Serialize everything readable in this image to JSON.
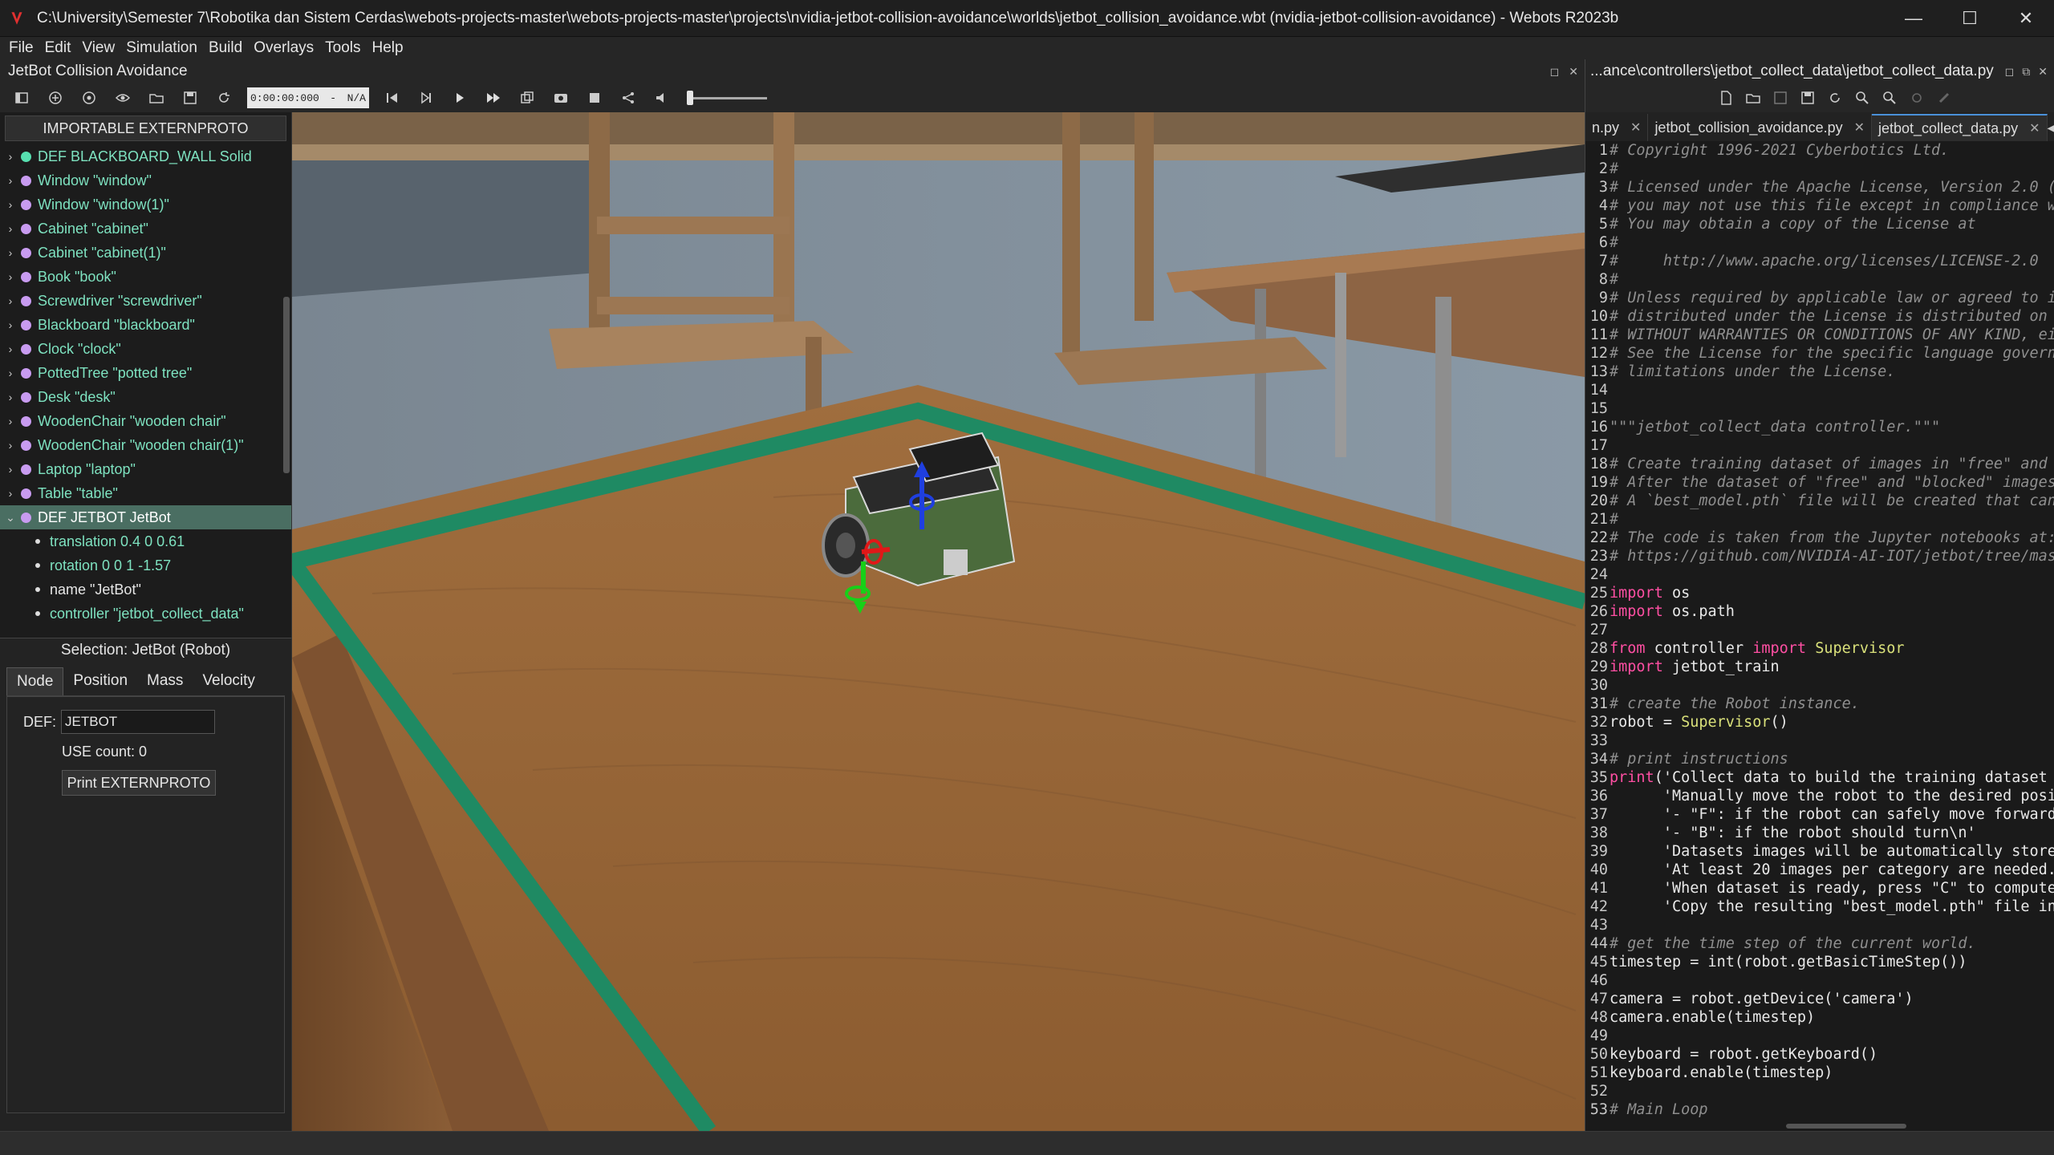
{
  "window": {
    "title": "C:\\University\\Semester 7\\Robotika dan Sistem Cerdas\\webots-projects-master\\webots-projects-master\\projects\\nvidia-jetbot-collision-avoidance\\worlds\\jetbot_collision_avoidance.wbt (nvidia-jetbot-collision-avoidance) - Webots R2023b",
    "minimize": "—",
    "maximize": "☐",
    "close": "✕"
  },
  "menu": [
    "File",
    "Edit",
    "View",
    "Simulation",
    "Build",
    "Overlays",
    "Tools",
    "Help"
  ],
  "left_header": {
    "title": "JetBot Collision Avoidance"
  },
  "toolbar": {
    "time": "0:00:00:000",
    "time_sep": "-",
    "speed": "N/A"
  },
  "scene_tree": {
    "importable_label": "IMPORTABLE EXTERNPROTO",
    "items": [
      {
        "label": "DEF BLACKBOARD_WALL Solid",
        "dot": "green"
      },
      {
        "label": "Window \"window\"",
        "dot": "purple"
      },
      {
        "label": "Window \"window(1)\"",
        "dot": "purple"
      },
      {
        "label": "Cabinet \"cabinet\"",
        "dot": "purple"
      },
      {
        "label": "Cabinet \"cabinet(1)\"",
        "dot": "purple"
      },
      {
        "label": "Book \"book\"",
        "dot": "purple"
      },
      {
        "label": "Screwdriver \"screwdriver\"",
        "dot": "purple"
      },
      {
        "label": "Blackboard \"blackboard\"",
        "dot": "purple"
      },
      {
        "label": "Clock \"clock\"",
        "dot": "purple"
      },
      {
        "label": "PottedTree \"potted tree\"",
        "dot": "purple"
      },
      {
        "label": "Desk \"desk\"",
        "dot": "purple"
      },
      {
        "label": "WoodenChair \"wooden chair\"",
        "dot": "purple"
      },
      {
        "label": "WoodenChair \"wooden chair(1)\"",
        "dot": "purple"
      },
      {
        "label": "Laptop \"laptop\"",
        "dot": "purple"
      },
      {
        "label": "Table \"table\"",
        "dot": "purple"
      },
      {
        "label": "DEF JETBOT JetBot",
        "dot": "purple"
      }
    ],
    "children": [
      {
        "label": "translation 0.4 0 0.61"
      },
      {
        "label": "rotation 0 0 1 -1.57"
      },
      {
        "label": "name \"JetBot\""
      },
      {
        "label": "controller \"jetbot_collect_data\""
      }
    ]
  },
  "selection": {
    "title": "Selection: JetBot (Robot)",
    "tabs": [
      "Node",
      "Position",
      "Mass",
      "Velocity"
    ],
    "def_label": "DEF:",
    "def_value": "JETBOT",
    "use_count": "USE count: 0",
    "print_button": "Print EXTERNPROTO"
  },
  "editor": {
    "path": "...ance\\controllers\\jetbot_collect_data\\jetbot_collect_data.py",
    "tabs": [
      {
        "label": "n.py",
        "active": false
      },
      {
        "label": "jetbot_collision_avoidance.py",
        "active": false
      },
      {
        "label": "jetbot_collect_data.py",
        "active": true
      }
    ],
    "lines": [
      {
        "n": "1",
        "parts": [
          [
            "c",
            "# Copyright 1996-2021 Cyberbotics Ltd."
          ]
        ]
      },
      {
        "n": "2",
        "parts": [
          [
            "c",
            "#"
          ]
        ]
      },
      {
        "n": "3",
        "parts": [
          [
            "c",
            "# Licensed under the Apache License, Version 2.0 ("
          ]
        ]
      },
      {
        "n": "4",
        "parts": [
          [
            "c",
            "# you may not use this file except in compliance w"
          ]
        ]
      },
      {
        "n": "5",
        "parts": [
          [
            "c",
            "# You may obtain a copy of the License at"
          ]
        ]
      },
      {
        "n": "6",
        "parts": [
          [
            "c",
            "#"
          ]
        ]
      },
      {
        "n": "7",
        "parts": [
          [
            "c",
            "#     http://www.apache.org/licenses/LICENSE-2.0"
          ]
        ]
      },
      {
        "n": "8",
        "parts": [
          [
            "c",
            "#"
          ]
        ]
      },
      {
        "n": "9",
        "parts": [
          [
            "c",
            "# Unless required by applicable law or agreed to i"
          ]
        ]
      },
      {
        "n": "10",
        "parts": [
          [
            "c",
            "# distributed under the License is distributed on"
          ]
        ]
      },
      {
        "n": "11",
        "parts": [
          [
            "c",
            "# WITHOUT WARRANTIES OR CONDITIONS OF ANY KIND, ei"
          ]
        ]
      },
      {
        "n": "12",
        "parts": [
          [
            "c",
            "# See the License for the specific language govern"
          ]
        ]
      },
      {
        "n": "13",
        "parts": [
          [
            "c",
            "# limitations under the License."
          ]
        ]
      },
      {
        "n": "14",
        "parts": []
      },
      {
        "n": "15",
        "parts": []
      },
      {
        "n": "16",
        "parts": [
          [
            "c",
            "\"\"\"jetbot_collect_data controller.\"\"\""
          ]
        ]
      },
      {
        "n": "17",
        "parts": []
      },
      {
        "n": "18",
        "parts": [
          [
            "c",
            "# Create training dataset of images in \"free\" and"
          ]
        ]
      },
      {
        "n": "19",
        "parts": [
          [
            "c",
            "# After the dataset of \"free\" and \"blocked\" images"
          ]
        ]
      },
      {
        "n": "20",
        "parts": [
          [
            "c",
            "# A `best_model.pth` file will be created that can"
          ]
        ]
      },
      {
        "n": "21",
        "parts": [
          [
            "c",
            "#"
          ]
        ]
      },
      {
        "n": "22",
        "parts": [
          [
            "c",
            "# The code is taken from the Jupyter notebooks at:"
          ]
        ]
      },
      {
        "n": "23",
        "parts": [
          [
            "c",
            "# https://github.com/NVIDIA-AI-IOT/jetbot/tree/mas"
          ]
        ]
      },
      {
        "n": "24",
        "parts": []
      },
      {
        "n": "25",
        "parts": [
          [
            "k",
            "import"
          ],
          [
            "t",
            " os"
          ]
        ]
      },
      {
        "n": "26",
        "parts": [
          [
            "k",
            "import"
          ],
          [
            "t",
            " os.path"
          ]
        ]
      },
      {
        "n": "27",
        "parts": []
      },
      {
        "n": "28",
        "parts": [
          [
            "k",
            "from"
          ],
          [
            "t",
            " controller "
          ],
          [
            "k",
            "import"
          ],
          [
            "t",
            " "
          ],
          [
            "y",
            "Supervisor"
          ]
        ]
      },
      {
        "n": "29",
        "parts": [
          [
            "k",
            "import"
          ],
          [
            "t",
            " jetbot_train"
          ]
        ]
      },
      {
        "n": "30",
        "parts": []
      },
      {
        "n": "31",
        "parts": [
          [
            "c",
            "# create the Robot instance."
          ]
        ]
      },
      {
        "n": "32",
        "parts": [
          [
            "t",
            "robot = "
          ],
          [
            "y",
            "Supervisor"
          ],
          [
            "t",
            "()"
          ]
        ]
      },
      {
        "n": "33",
        "parts": []
      },
      {
        "n": "34",
        "parts": [
          [
            "c",
            "# print instructions"
          ]
        ]
      },
      {
        "n": "35",
        "parts": [
          [
            "k",
            "print"
          ],
          [
            "t",
            "('Collect data to build the training dataset"
          ]
        ]
      },
      {
        "n": "36",
        "parts": [
          [
            "t",
            "      'Manually move the robot to the desired posi"
          ]
        ]
      },
      {
        "n": "37",
        "parts": [
          [
            "t",
            "      '- \"F\": if the robot can safely move forward"
          ]
        ]
      },
      {
        "n": "38",
        "parts": [
          [
            "t",
            "      '- \"B\": if the robot should turn\\n'"
          ]
        ]
      },
      {
        "n": "39",
        "parts": [
          [
            "t",
            "      'Datasets images will be automatically store"
          ]
        ]
      },
      {
        "n": "40",
        "parts": [
          [
            "t",
            "      'At least 20 images per category are needed."
          ]
        ]
      },
      {
        "n": "41",
        "parts": [
          [
            "t",
            "      'When dataset is ready, press \"C\" to compute"
          ]
        ]
      },
      {
        "n": "42",
        "parts": [
          [
            "t",
            "      'Copy the resulting \"best_model.pth\" file in"
          ]
        ]
      },
      {
        "n": "43",
        "parts": []
      },
      {
        "n": "44",
        "parts": [
          [
            "c",
            "# get the time step of the current world."
          ]
        ]
      },
      {
        "n": "45",
        "parts": [
          [
            "t",
            "timestep = int(robot.getBasicTimeStep())"
          ]
        ]
      },
      {
        "n": "46",
        "parts": []
      },
      {
        "n": "47",
        "parts": [
          [
            "t",
            "camera = robot.getDevice('camera')"
          ]
        ]
      },
      {
        "n": "48",
        "parts": [
          [
            "t",
            "camera.enable(timestep)"
          ]
        ]
      },
      {
        "n": "49",
        "parts": []
      },
      {
        "n": "50",
        "parts": [
          [
            "t",
            "keyboard = robot.getKeyboard()"
          ]
        ]
      },
      {
        "n": "51",
        "parts": [
          [
            "t",
            "keyboard.enable(timestep)"
          ]
        ]
      },
      {
        "n": "52",
        "parts": []
      },
      {
        "n": "53",
        "parts": [
          [
            "c",
            "# Main Loop"
          ]
        ]
      }
    ]
  },
  "colors": {
    "tree_green": "#57e0b0",
    "tree_purple": "#c89bf0",
    "selected_row": "#4a6e62",
    "keyword": "#ff4fa3",
    "class_name": "#d9e07a",
    "comment": "#8f8f8f",
    "tape": "#1f8a63"
  }
}
